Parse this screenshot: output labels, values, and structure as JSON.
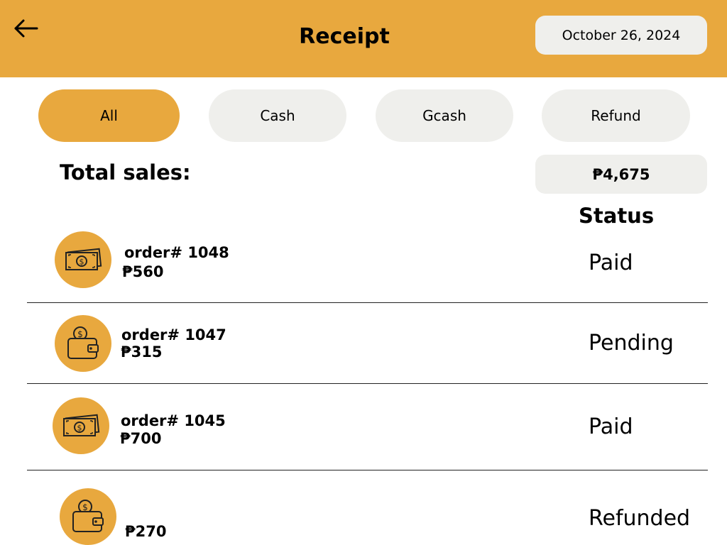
{
  "header": {
    "title": "Receipt",
    "date": "October 26, 2024",
    "back_icon": "arrow-left-icon"
  },
  "tabs": [
    {
      "label": "All",
      "active": true
    },
    {
      "label": "Cash",
      "active": false
    },
    {
      "label": "Gcash",
      "active": false
    },
    {
      "label": "Refund",
      "active": false
    }
  ],
  "summary": {
    "total_label": "Total sales:",
    "total_value": "₱4,675",
    "status_header": "Status"
  },
  "orders": [
    {
      "order_id": "order# 1048",
      "amount": "₱560",
      "status": "Paid",
      "icon": "cash-bill-icon"
    },
    {
      "order_id": "order# 1047",
      "amount": "₱315",
      "status": "Pending",
      "icon": "wallet-coin-icon"
    },
    {
      "order_id": "order# 1045",
      "amount": "₱700",
      "status": "Paid",
      "icon": "cash-bill-icon"
    },
    {
      "order_id": "",
      "amount": "₱270",
      "status": "Refunded",
      "icon": "wallet-coin-icon"
    }
  ],
  "colors": {
    "accent": "#e8a83e",
    "chip_bg": "#efefec",
    "divider": "#222222"
  }
}
